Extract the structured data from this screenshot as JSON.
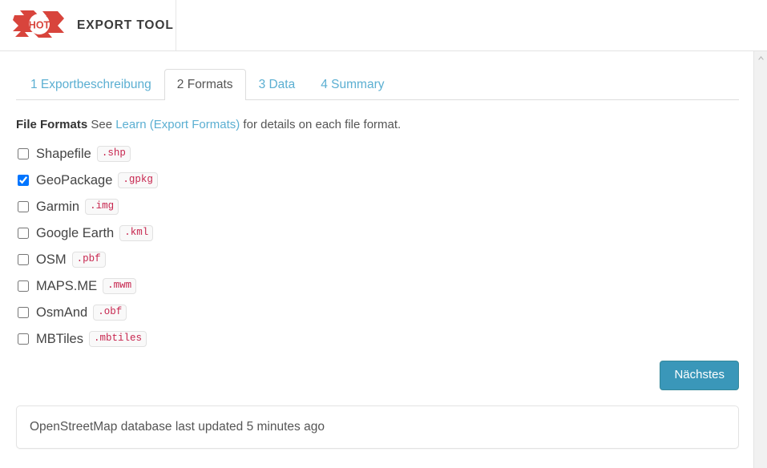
{
  "navbar": {
    "brand_title": "EXPORT TOOL",
    "logo_text": "HOT",
    "logo_color": "#d8443c"
  },
  "tabs": [
    {
      "label": "1 Exportbeschreibung",
      "active": false
    },
    {
      "label": "2 Formats",
      "active": true
    },
    {
      "label": "3 Data",
      "active": false
    },
    {
      "label": "4 Summary",
      "active": false
    }
  ],
  "formats_section": {
    "heading": "File Formats",
    "help_prefix": "See ",
    "help_link": "Learn (Export Formats)",
    "help_suffix": " for details on each file format.",
    "items": [
      {
        "name": "Shapefile",
        "ext": ".shp",
        "checked": false
      },
      {
        "name": "GeoPackage",
        "ext": ".gpkg",
        "checked": true
      },
      {
        "name": "Garmin",
        "ext": ".img",
        "checked": false
      },
      {
        "name": "Google Earth",
        "ext": ".kml",
        "checked": false
      },
      {
        "name": "OSM",
        "ext": ".pbf",
        "checked": false
      },
      {
        "name": "MAPS.ME",
        "ext": ".mwm",
        "checked": false
      },
      {
        "name": "OsmAnd",
        "ext": ".obf",
        "checked": false
      },
      {
        "name": "MBTiles",
        "ext": ".mbtiles",
        "checked": false
      }
    ]
  },
  "actions": {
    "next_label": "Nächstes",
    "next_color": "#3a97b9"
  },
  "status_panel": {
    "text": "OpenStreetMap database last updated 5 minutes ago"
  },
  "scrollbar": {
    "up_arrow": "scroll-up-arrow"
  },
  "colors": {
    "link": "#5bafd2",
    "badge_text": "#c7254e",
    "brand_red": "#d8443c"
  }
}
